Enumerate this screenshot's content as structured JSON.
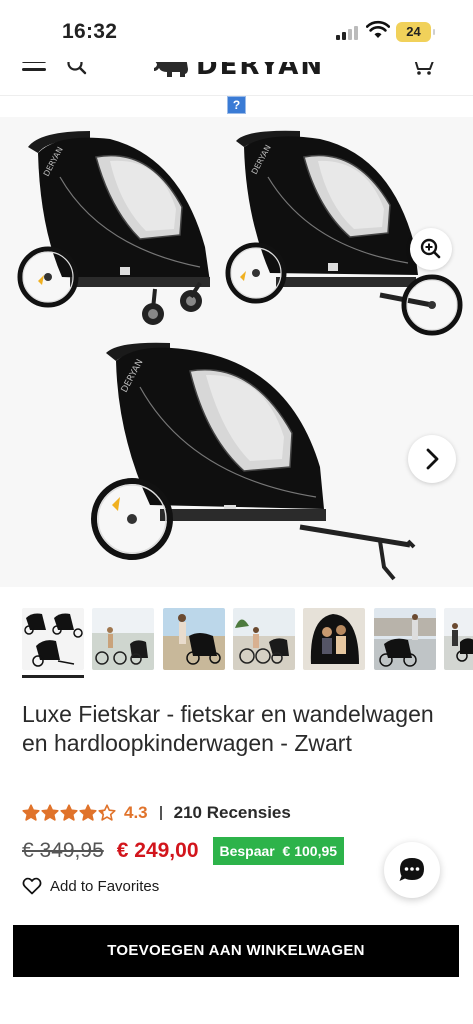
{
  "status_bar": {
    "time": "16:32",
    "battery": "24",
    "icons": [
      "cellular-signal-icon",
      "wifi-icon",
      "battery-icon"
    ]
  },
  "header": {
    "logo_text": "DERYAN",
    "icons": [
      "menu-icon",
      "search-icon",
      "cart-icon"
    ]
  },
  "help_badge": "?",
  "gallery": {
    "icons": [
      "zoom-in-icon",
      "chevron-right-icon"
    ],
    "thumbnail_count": 7,
    "active_thumbnail": 1
  },
  "product": {
    "title": "Luxe Fietskar - fietskar en wandelwagen en hardloopkinderwagen - Zwart",
    "rating": {
      "value": "4.3",
      "stars": 4.3,
      "max_stars": 5,
      "reviews": "210 Recensies"
    },
    "old_price": "€ 349,95",
    "new_price": "€ 249,00",
    "save_badge": "Bespaar  € 100,95",
    "favorites_label": "Add to Favorites"
  },
  "cta": {
    "add_to_cart": "TOEVOEGEN AAN WINKELWAGEN"
  },
  "colors": {
    "accent_star": "#e0732b",
    "sale_price": "#d2151c",
    "save_badge": "#2db34a",
    "cta_background": "#000000"
  }
}
